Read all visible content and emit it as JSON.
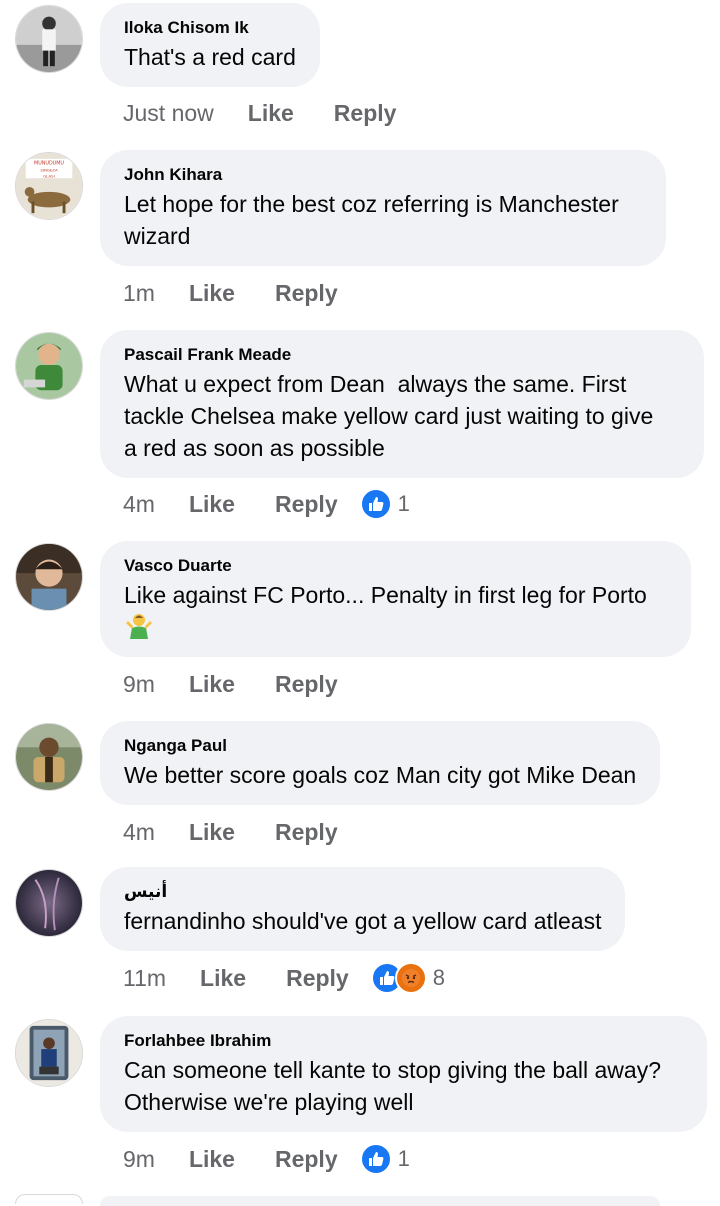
{
  "comments": [
    {
      "author": "Iloka Chisom Ik",
      "text": "That's a red card",
      "time": "Just now",
      "like": "Like",
      "reply": "Reply",
      "reactions": null
    },
    {
      "author": "John Kihara",
      "text": "Let hope for the best coz referring is Manchester\nwizard",
      "time": "1m",
      "like": "Like",
      "reply": "Reply",
      "reactions": null
    },
    {
      "author": "Pascail Frank Meade",
      "text": "What u expect from Dean  always the same. First\ntackle Chelsea make yellow card just waiting to give\na red as soon as possible",
      "time": "4m",
      "like": "Like",
      "reply": "Reply",
      "reactions": {
        "icons": [
          "like-icon"
        ],
        "count": "1"
      }
    },
    {
      "author": "Vasco Duarte",
      "text": "Like against FC Porto... Penalty in first leg for Porto",
      "emoji": "person-shrugging-emoji",
      "time": "9m",
      "like": "Like",
      "reply": "Reply",
      "reactions": null
    },
    {
      "author": "Nganga Paul",
      "text": "We better score goals coz Man city got Mike Dean",
      "time": "4m",
      "like": "Like",
      "reply": "Reply",
      "reactions": null
    },
    {
      "author": "أنيس",
      "text": "fernandinho should've got a yellow card atleast",
      "time": "11m",
      "like": "Like",
      "reply": "Reply",
      "reactions": {
        "icons": [
          "like-icon",
          "angry-icon"
        ],
        "count": "8"
      }
    },
    {
      "author": "Forlahbee Ibrahim",
      "text": "Can someone tell kante to stop giving the ball away?\nOtherwise we're playing well",
      "time": "9m",
      "like": "Like",
      "reply": "Reply",
      "reactions": {
        "icons": [
          "like-icon"
        ],
        "count": "1"
      }
    }
  ],
  "colors": {
    "bubble": "#f0f2f5",
    "meta_text": "#65676b",
    "like_blue": "#1877f2",
    "angry_orange": "#e9710f"
  }
}
